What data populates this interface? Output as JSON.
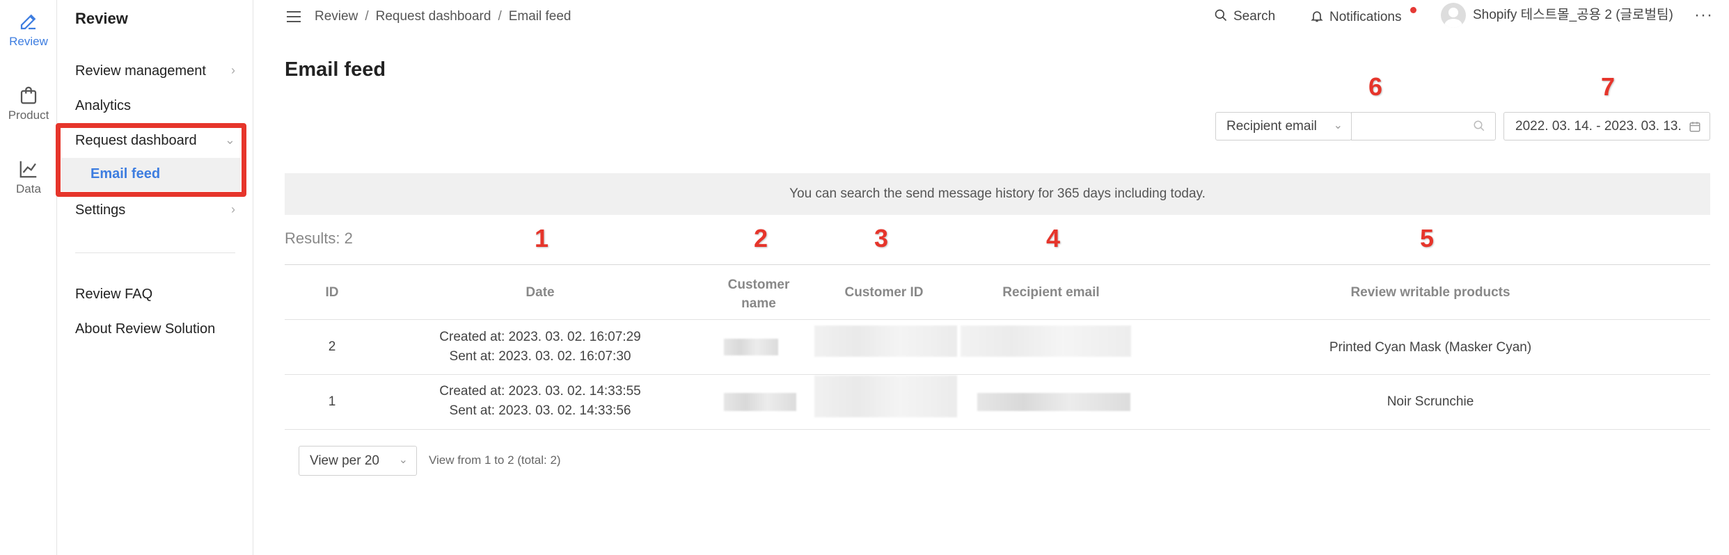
{
  "rail": {
    "items": [
      {
        "label": "Review",
        "icon": "edit-icon",
        "active": true
      },
      {
        "label": "Product",
        "icon": "bag-icon",
        "active": false
      },
      {
        "label": "Data",
        "icon": "chart-line-icon",
        "active": false
      }
    ]
  },
  "sidebar": {
    "title": "Review",
    "items": [
      {
        "label": "Review management"
      },
      {
        "label": "Analytics"
      },
      {
        "label": "Request dashboard"
      },
      {
        "label": "Email feed"
      },
      {
        "label": "Settings"
      },
      {
        "label": "Review FAQ"
      },
      {
        "label": "About Review Solution"
      }
    ]
  },
  "topbar": {
    "breadcrumb": [
      "Review",
      "Request dashboard",
      "Email feed"
    ],
    "search_label": "Search",
    "notifications_label": "Notifications",
    "user_label": "Shopify 테스트몰_공용 2 (글로벌팀)",
    "more": "···"
  },
  "main": {
    "title": "Email feed",
    "annotations": [
      "1",
      "2",
      "3",
      "4",
      "5",
      "6",
      "7"
    ],
    "filter": {
      "field_label": "Recipient email",
      "search_value": "",
      "date_range": "2022. 03. 14. - 2023. 03. 13."
    },
    "banner": "You can search the send message history for 365 days including today.",
    "results": "Results: 2",
    "table": {
      "headers": {
        "id": "ID",
        "date": "Date",
        "customer_name_1": "Customer",
        "customer_name_2": "name",
        "customer_id": "Customer ID",
        "recipient_email": "Recipient email",
        "products": "Review writable products"
      },
      "rows": [
        {
          "id": "2",
          "created": "Created at: 2023. 03. 02. 16:07:29",
          "sent": "Sent at: 2023. 03. 02. 16:07:30",
          "product": "Printed Cyan Mask (Masker Cyan)"
        },
        {
          "id": "1",
          "created": "Created at: 2023. 03. 02. 14:33:55",
          "sent": "Sent at: 2023. 03. 02. 14:33:56",
          "product": "Noir Scrunchie"
        }
      ]
    },
    "pagination": {
      "per_page": "View per 20",
      "range": "View from 1 to 2 (total: 2)"
    }
  },
  "colors": {
    "accent": "#3d7de0",
    "highlight": "#e6352b",
    "banner_bg": "#f0f0f0"
  }
}
